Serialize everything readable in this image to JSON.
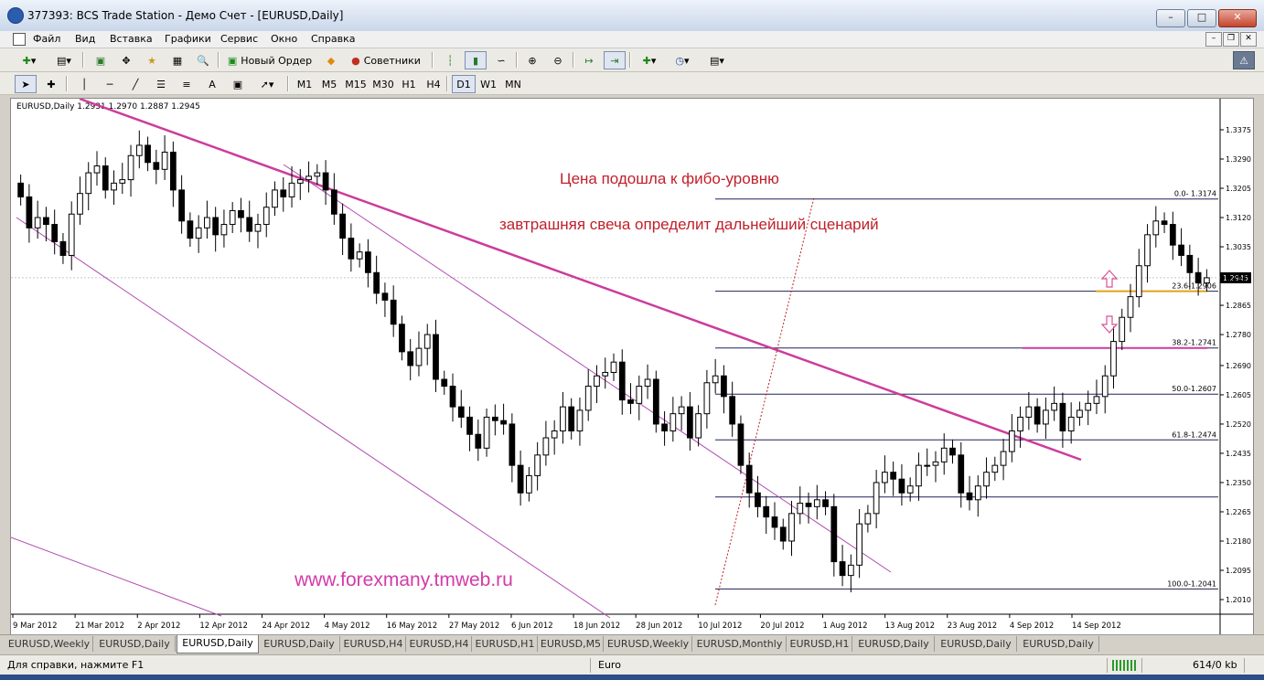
{
  "window": {
    "title": "377393: BCS Trade Station - Демо Счет - [EURUSD,Daily]"
  },
  "menu": [
    "Файл",
    "Вид",
    "Вставка",
    "Графики",
    "Сервис",
    "Окно",
    "Справка"
  ],
  "toolbar": {
    "new_order": "Новый Ордер",
    "experts": "Советники"
  },
  "timeframes": [
    "M1",
    "M5",
    "M15",
    "M30",
    "H1",
    "H4",
    "D1",
    "W1",
    "MN"
  ],
  "active_timeframe": "D1",
  "chart": {
    "header": "EURUSD,Daily  1.2931 1.2970 1.2887 1.2945",
    "current_price": "1.2945",
    "watermark": "www.forexmany.tmweb.ru"
  },
  "annotations": {
    "line1": "Цена подошла к фибо-уровню",
    "line2": "завтрашняя свеча определит дальнейший сценарий"
  },
  "chart_data": {
    "type": "candlestick",
    "symbol": "EURUSD",
    "timeframe": "Daily",
    "ohlc_last": {
      "open": 1.2931,
      "high": 1.297,
      "low": 1.2887,
      "close": 1.2945
    },
    "y_ticks": [
      "1.3375",
      "1.3290",
      "1.3205",
      "1.3120",
      "1.3035",
      "1.2945",
      "1.2865",
      "1.2780",
      "1.2690",
      "1.2605",
      "1.2520",
      "1.2435",
      "1.2350",
      "1.2265",
      "1.2180",
      "1.2095",
      "1.2010"
    ],
    "x_ticks": [
      "9 Mar 2012",
      "21 Mar 2012",
      "2 Apr 2012",
      "12 Apr 2012",
      "24 Apr 2012",
      "4 May 2012",
      "16 May 2012",
      "27 May 2012",
      "6 Jun 2012",
      "18 Jun 2012",
      "28 Jun 2012",
      "10 Jul 2012",
      "20 Jul 2012",
      "1 Aug 2012",
      "13 Aug 2012",
      "23 Aug 2012",
      "4 Sep 2012",
      "14 Sep 2012"
    ],
    "fibonacci": [
      {
        "label": "0.0- 1.3174",
        "price": 1.3174
      },
      {
        "label": "23.6-1.2906",
        "price": 1.2906
      },
      {
        "label": "38.2-1.2741",
        "price": 1.2741
      },
      {
        "label": "50.0-1.2607",
        "price": 1.2607
      },
      {
        "label": "61.8-1.2474",
        "price": 1.2474
      },
      {
        "label": "",
        "price": 1.2308
      },
      {
        "label": "100.0-1.2041",
        "price": 1.2041
      }
    ],
    "closes": [
      1.318,
      1.309,
      1.312,
      1.31,
      1.305,
      1.301,
      1.313,
      1.319,
      1.325,
      1.327,
      1.32,
      1.322,
      1.323,
      1.33,
      1.333,
      1.328,
      1.326,
      1.331,
      1.32,
      1.311,
      1.306,
      1.309,
      1.312,
      1.307,
      1.31,
      1.314,
      1.312,
      1.308,
      1.31,
      1.315,
      1.32,
      1.318,
      1.322,
      1.323,
      1.324,
      1.325,
      1.32,
      1.313,
      1.306,
      1.3,
      1.302,
      1.296,
      1.29,
      1.288,
      1.281,
      1.273,
      1.269,
      1.274,
      1.278,
      1.265,
      1.263,
      1.257,
      1.254,
      1.249,
      1.245,
      1.254,
      1.253,
      1.252,
      1.24,
      1.232,
      1.237,
      1.243,
      1.248,
      1.25,
      1.257,
      1.25,
      1.256,
      1.263,
      1.266,
      1.267,
      1.27,
      1.259,
      1.258,
      1.263,
      1.265,
      1.252,
      1.25,
      1.255,
      1.257,
      1.248,
      1.255,
      1.264,
      1.266,
      1.26,
      1.252,
      1.24,
      1.232,
      1.228,
      1.225,
      1.222,
      1.218,
      1.226,
      1.229,
      1.228,
      1.23,
      1.228,
      1.212,
      1.208,
      1.211,
      1.223,
      1.226,
      1.235,
      1.238,
      1.236,
      1.232,
      1.234,
      1.24,
      1.24,
      1.241,
      1.245,
      1.243,
      1.232,
      1.23,
      1.234,
      1.238,
      1.24,
      1.244,
      1.25,
      1.254,
      1.257,
      1.252,
      1.256,
      1.258,
      1.25,
      1.254,
      1.256,
      1.258,
      1.26,
      1.266,
      1.276,
      1.283,
      1.289,
      1.298,
      1.307,
      1.311,
      1.31,
      1.304,
      1.301,
      1.296,
      1.293,
      1.2945
    ]
  },
  "tabs": [
    "EURUSD,Weekly",
    "EURUSD,Daily",
    "EURUSD,Daily",
    "EURUSD,Daily",
    "EURUSD,H4",
    "EURUSD,H4",
    "EURUSD,H1",
    "EURUSD,M5",
    "EURUSD,Weekly",
    "EURUSD,Monthly",
    "EURUSD,H1",
    "EURUSD,Daily",
    "EURUSD,Daily",
    "EURUSD,Daily"
  ],
  "active_tab_index": 2,
  "status": {
    "help": "Для справки, нажмите F1",
    "profile": "Euro",
    "traffic": "614/0 kb"
  }
}
